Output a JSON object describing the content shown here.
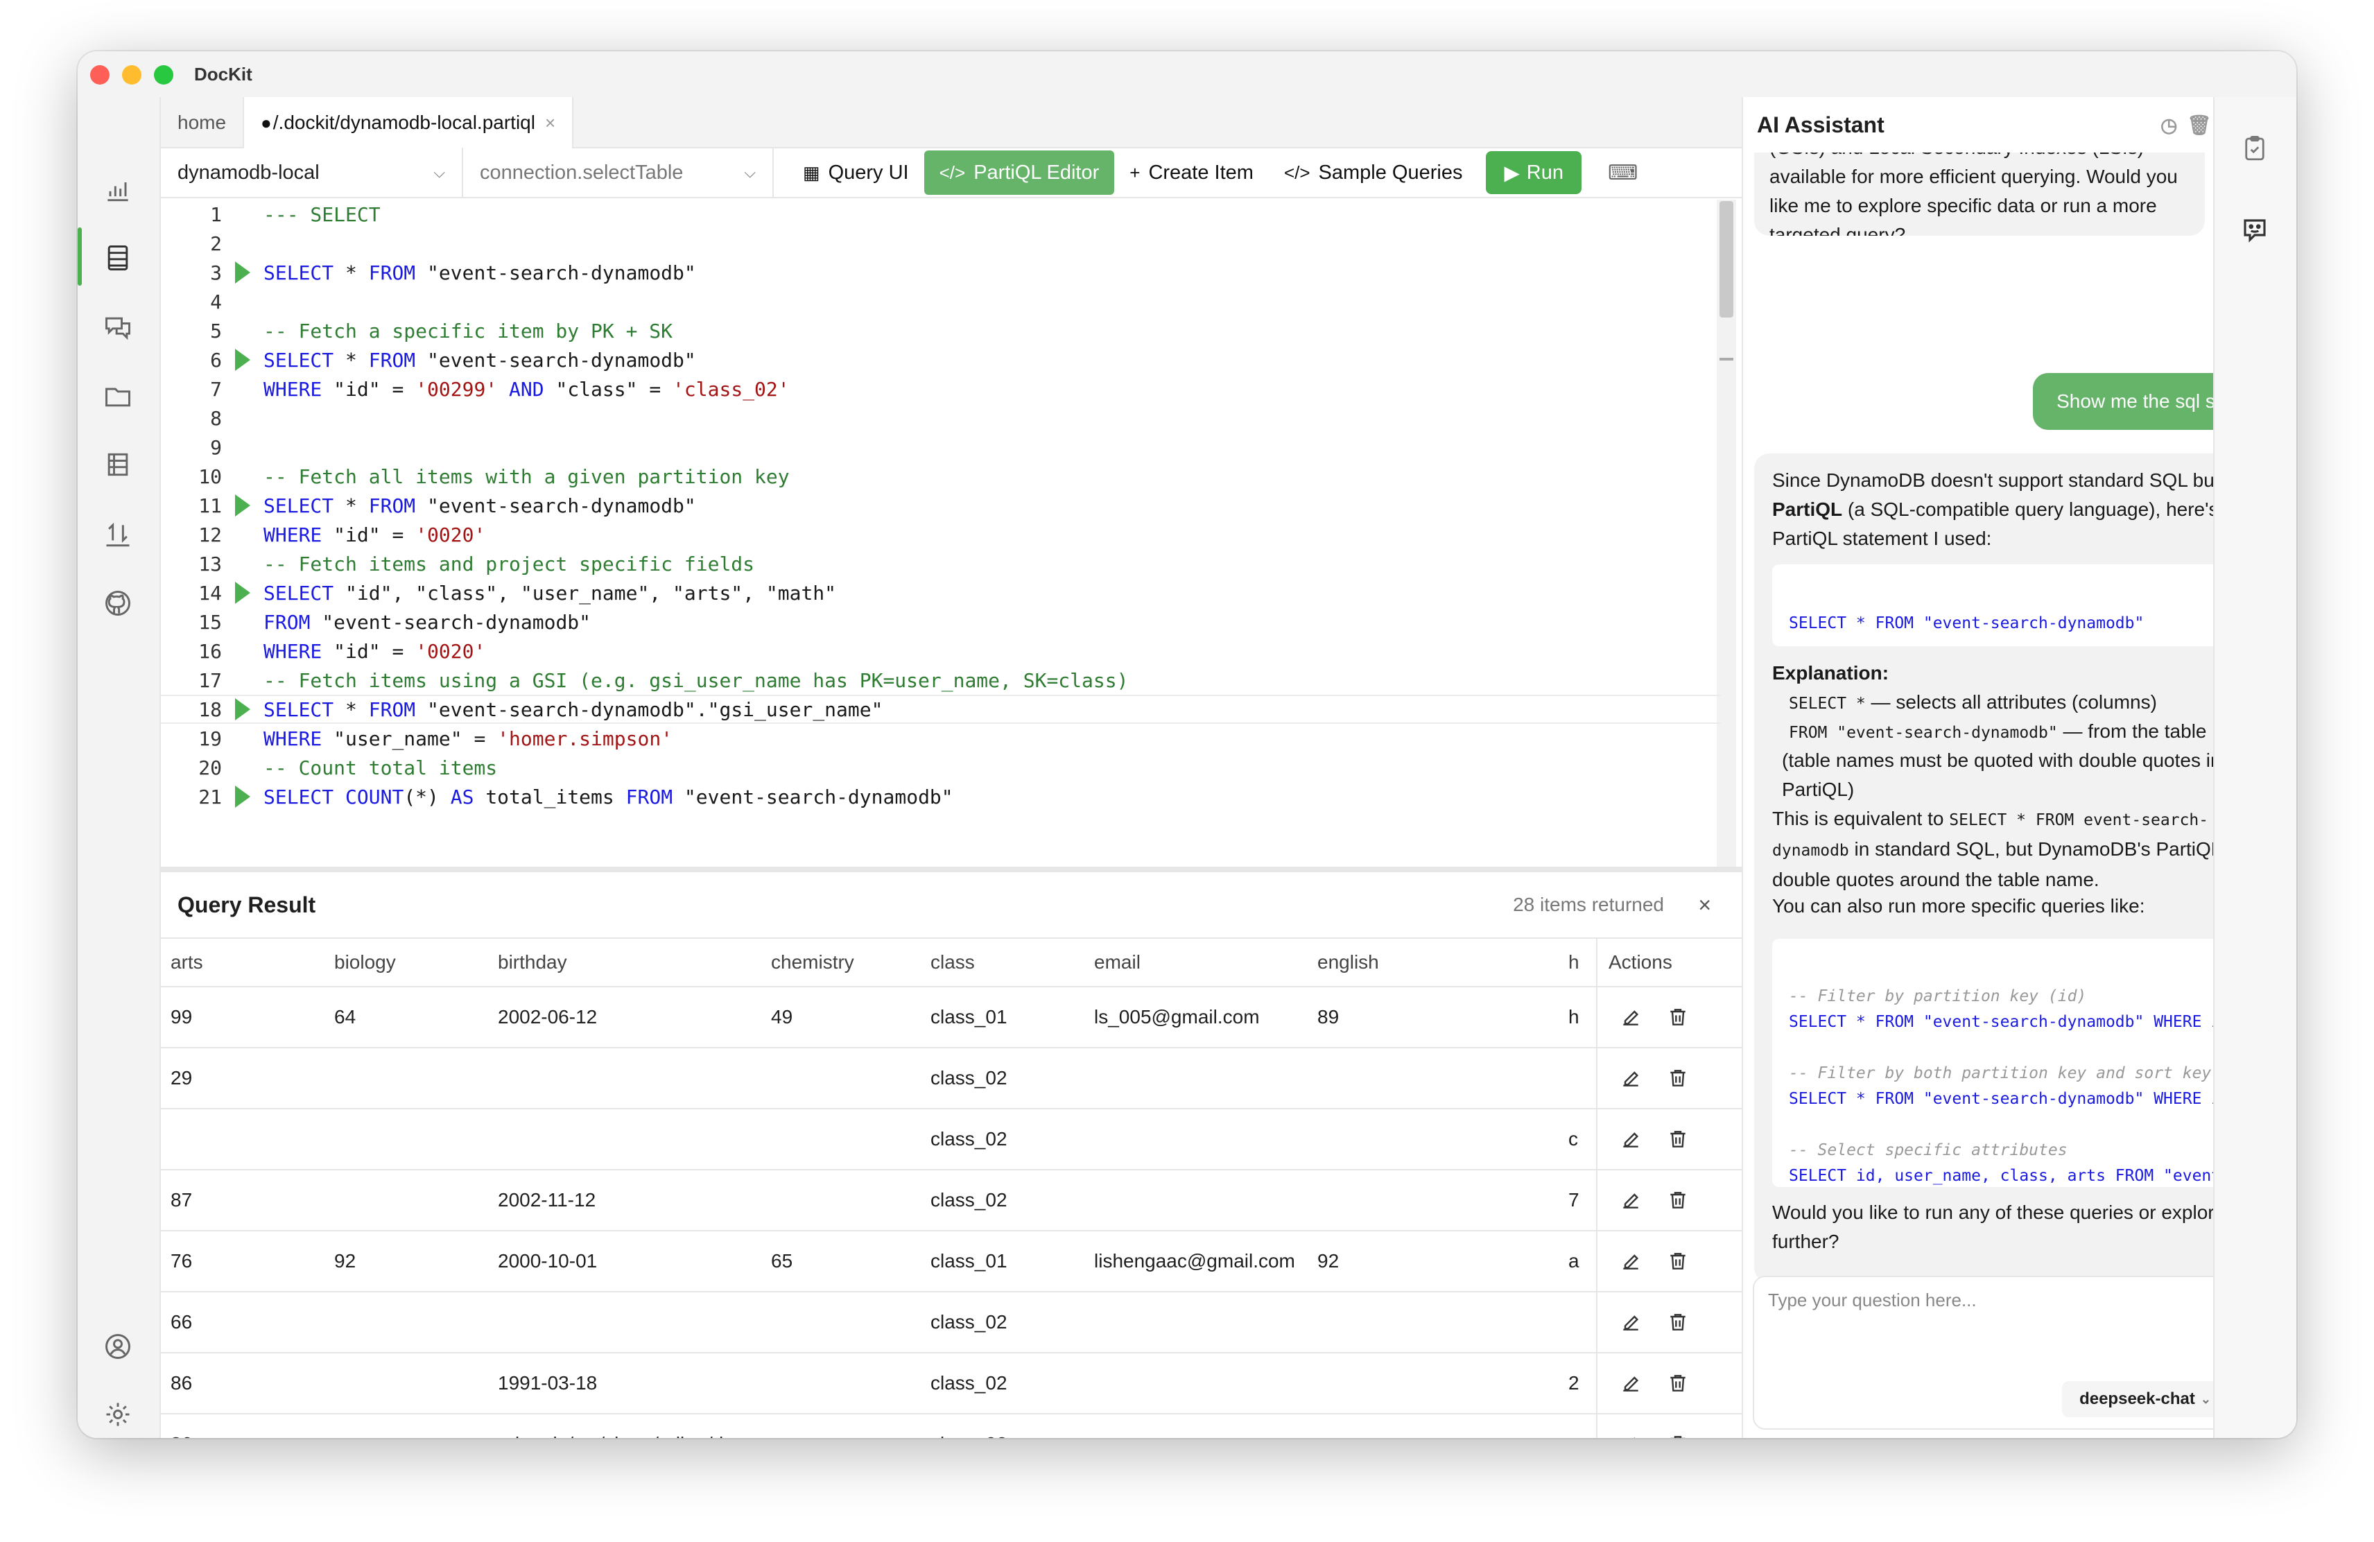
{
  "app": {
    "title": "DocKit"
  },
  "tabs": [
    {
      "label": "home"
    },
    {
      "label": "/.dockit/dynamodb-local.partiql",
      "close": "×"
    }
  ],
  "toolbar": {
    "connection": "dynamodb-local",
    "table_placeholder": "connection.selectTable",
    "query_ui": "Query UI",
    "partiql_editor": "PartiQL Editor",
    "create_item": "Create Item",
    "sample_queries": "Sample Queries",
    "run": "Run"
  },
  "editor": {
    "lines": [
      {
        "n": "1",
        "text": "--- SELECT",
        "type": "comment"
      },
      {
        "n": "2",
        "text": ""
      },
      {
        "n": "3",
        "text": "SELECT * FROM \"event-search-dynamodb\"",
        "run": true
      },
      {
        "n": "4",
        "text": ""
      },
      {
        "n": "5",
        "text": "-- Fetch a specific item by PK + SK",
        "type": "comment"
      },
      {
        "n": "6",
        "text": "SELECT * FROM \"event-search-dynamodb\"",
        "run": true
      },
      {
        "n": "7",
        "text": "WHERE \"id\" = '00299' AND \"class\" = 'class_02'"
      },
      {
        "n": "8",
        "text": ""
      },
      {
        "n": "9",
        "text": ""
      },
      {
        "n": "10",
        "text": "-- Fetch all items with a given partition key",
        "type": "comment"
      },
      {
        "n": "11",
        "text": "SELECT * FROM \"event-search-dynamodb\"",
        "run": true
      },
      {
        "n": "12",
        "text": "WHERE \"id\" = '0020'"
      },
      {
        "n": "13",
        "text": "-- Fetch items and project specific fields",
        "type": "comment"
      },
      {
        "n": "14",
        "text": "SELECT \"id\", \"class\", \"user_name\", \"arts\", \"math\"",
        "run": true
      },
      {
        "n": "15",
        "text": "FROM \"event-search-dynamodb\""
      },
      {
        "n": "16",
        "text": "WHERE \"id\" = '0020'"
      },
      {
        "n": "17",
        "text": "-- Fetch items using a GSI (e.g. gsi_user_name has PK=user_name, SK=class)",
        "type": "comment"
      },
      {
        "n": "18",
        "text": "SELECT * FROM \"event-search-dynamodb\".\"gsi_user_name\"",
        "run": true,
        "current": true
      },
      {
        "n": "19",
        "text": "WHERE \"user_name\" = 'homer.simpson'"
      },
      {
        "n": "20",
        "text": "-- Count total items",
        "type": "comment"
      },
      {
        "n": "21",
        "text": "SELECT COUNT(*) AS total_items FROM \"event-search-dynamodb\"",
        "run": true
      }
    ]
  },
  "result": {
    "title": "Query Result",
    "count": "28 items returned",
    "close": "×",
    "columns": [
      "arts",
      "biology",
      "birthday",
      "chemistry",
      "class",
      "email",
      "english",
      "h",
      "Actions"
    ],
    "rows": [
      [
        "99",
        "64",
        "2002-06-12",
        "49",
        "class_01",
        "ls_005@gmail.com",
        "89",
        "h"
      ],
      [
        "29",
        "",
        "",
        "",
        "class_02",
        "",
        "",
        ""
      ],
      [
        "",
        "",
        "",
        "",
        "class_02",
        "",
        "",
        "c"
      ],
      [
        "87",
        "",
        "2002-11-12",
        "",
        "class_02",
        "",
        "",
        "7"
      ],
      [
        "76",
        "92",
        "2000-10-01",
        "65",
        "class_01",
        "lishengaac@gmail.com",
        "92",
        "a"
      ],
      [
        "66",
        "",
        "",
        "",
        "class_02",
        "",
        "",
        ""
      ],
      [
        "86",
        "",
        "1991-03-18",
        "",
        "class_02",
        "",
        "",
        "2"
      ],
      [
        "86",
        "",
        "pdated: /src/views/editor/d...",
        "",
        "class_02",
        "",
        "",
        "s"
      ]
    ]
  },
  "ai": {
    "title": "AI Assistant",
    "msg1": "There are also several Global Secondary Indexes (GSIs) and Local Secondary Indexes (LSIs) available for more efficient querying. Would you like me to explore specific data or run a more targeted query?",
    "user_msg": "Show me the sql statement",
    "msg2_p1": "Since DynamoDB doesn't support standard SQL but supports ",
    "msg2_bold": "PartiQL",
    "msg2_p2": " (a SQL-compatible query language), here's the PartiQL statement I used:",
    "code1": "SELECT * FROM \"event-search-dynamodb\"",
    "explanation": "Explanation:",
    "exp1_code": "SELECT *",
    "exp1_text": " — selects all attributes (columns)",
    "exp2_code": "FROM \"event-search-dynamodb\"",
    "exp2_text": " — from the table",
    "exp2_cont": "(table names must be quoted with double quotes in PartiQL)",
    "equiv_p1": "This is equivalent to ",
    "equiv_code": "SELECT * FROM event-search-",
    "equiv_code2": "dynamodb",
    "equiv_p2": " in standard SQL, but DynamoDB's PartiQL requires double quotes around the table name.",
    "also": "You can also run more specific queries like:",
    "code2": [
      "-- Filter by partition key (id)",
      "SELECT * FROM \"event-search-dynamodb\" WHERE id =",
      "",
      "-- Filter by both partition key and sort key",
      "SELECT * FROM \"event-search-dynamodb\" WHERE id =",
      "",
      "-- Select specific attributes",
      "SELECT id, user_name, class, arts FROM \"event-se"
    ],
    "closing": "Would you like to run any of these queries or explore the data further?",
    "input_placeholder": "Type your question here...",
    "model": "deepseek-chat"
  },
  "colors": {
    "accent": "#4caf50",
    "accent_light": "#66b36a"
  }
}
